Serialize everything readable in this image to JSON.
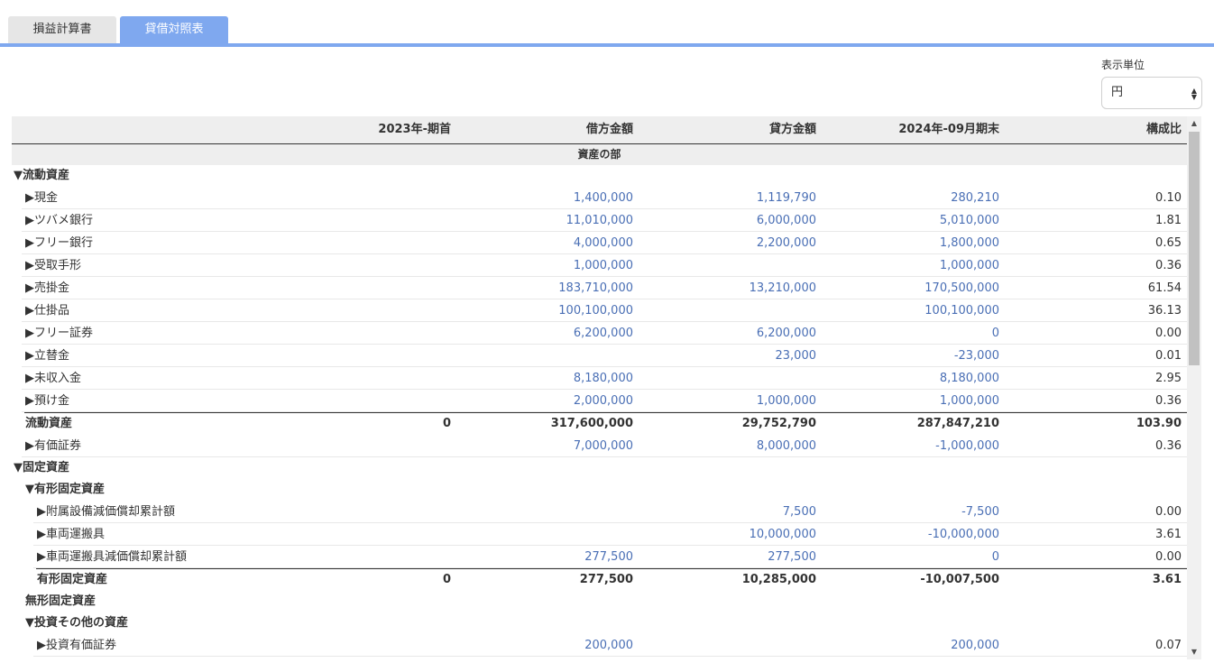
{
  "tabs": [
    {
      "label": "損益計算書",
      "active": false
    },
    {
      "label": "貸借対照表",
      "active": true
    }
  ],
  "unit": {
    "label": "表示単位",
    "value": "円"
  },
  "columns": {
    "prev": "2023年-期首",
    "debit": "借方金額",
    "credit": "貸方金額",
    "end": "2024年-09月期末",
    "ratio": "構成比"
  },
  "section_title": "資産の部",
  "rows": [
    {
      "type": "group",
      "level": 0,
      "label": "▼流動資産"
    },
    {
      "type": "item",
      "level": 1,
      "label": "▶現金",
      "debit": "1,400,000",
      "credit": "1,119,790",
      "end": "280,210",
      "ratio": "0.10"
    },
    {
      "type": "item",
      "level": 1,
      "label": "▶ツバメ銀行",
      "debit": "11,010,000",
      "credit": "6,000,000",
      "end": "5,010,000",
      "ratio": "1.81"
    },
    {
      "type": "item",
      "level": 1,
      "label": "▶フリー銀行",
      "debit": "4,000,000",
      "credit": "2,200,000",
      "end": "1,800,000",
      "ratio": "0.65"
    },
    {
      "type": "item",
      "level": 1,
      "label": "▶受取手形",
      "debit": "1,000,000",
      "credit": "",
      "end": "1,000,000",
      "ratio": "0.36"
    },
    {
      "type": "item",
      "level": 1,
      "label": "▶売掛金",
      "debit": "183,710,000",
      "credit": "13,210,000",
      "end": "170,500,000",
      "ratio": "61.54"
    },
    {
      "type": "item",
      "level": 1,
      "label": "▶仕掛品",
      "debit": "100,100,000",
      "credit": "",
      "end": "100,100,000",
      "ratio": "36.13"
    },
    {
      "type": "item",
      "level": 1,
      "label": "▶フリー証券",
      "debit": "6,200,000",
      "credit": "6,200,000",
      "end": "0",
      "ratio": "0.00"
    },
    {
      "type": "item",
      "level": 1,
      "label": "▶立替金",
      "debit": "",
      "credit": "23,000",
      "end": "-23,000",
      "ratio": "0.01"
    },
    {
      "type": "item",
      "level": 1,
      "label": "▶未収入金",
      "debit": "8,180,000",
      "credit": "",
      "end": "8,180,000",
      "ratio": "2.95"
    },
    {
      "type": "item",
      "level": 1,
      "label": "▶預け金",
      "debit": "2,000,000",
      "credit": "1,000,000",
      "end": "1,000,000",
      "ratio": "0.36"
    },
    {
      "type": "total",
      "level": 1,
      "label": "流動資産",
      "prev": "0",
      "debit": "317,600,000",
      "credit": "29,752,790",
      "end": "287,847,210",
      "ratio": "103.90"
    },
    {
      "type": "item",
      "level": 1,
      "label": "▶有価証券",
      "debit": "7,000,000",
      "credit": "8,000,000",
      "end": "-1,000,000",
      "ratio": "0.36"
    },
    {
      "type": "group",
      "level": 0,
      "label": "▼固定資産"
    },
    {
      "type": "group",
      "level": 1,
      "label": "▼有形固定資産"
    },
    {
      "type": "item",
      "level": 2,
      "label": "▶附属設備減価償却累計額",
      "debit": "",
      "credit": "7,500",
      "end": "-7,500",
      "ratio": "0.00"
    },
    {
      "type": "item",
      "level": 2,
      "label": "▶車両運搬具",
      "debit": "",
      "credit": "10,000,000",
      "end": "-10,000,000",
      "ratio": "3.61"
    },
    {
      "type": "item",
      "level": 2,
      "label": "▶車両運搬具減価償却累計額",
      "debit": "277,500",
      "credit": "277,500",
      "end": "0",
      "ratio": "0.00"
    },
    {
      "type": "total",
      "level": 2,
      "label": "有形固定資産",
      "prev": "0",
      "debit": "277,500",
      "credit": "10,285,000",
      "end": "-10,007,500",
      "ratio": "3.61"
    },
    {
      "type": "group",
      "level": 1,
      "label": "無形固定資産"
    },
    {
      "type": "group",
      "level": 1,
      "label": "▼投資その他の資産"
    },
    {
      "type": "item",
      "level": 2,
      "label": "▶投資有価証券",
      "debit": "200,000",
      "credit": "",
      "end": "200,000",
      "ratio": "0.07"
    }
  ]
}
